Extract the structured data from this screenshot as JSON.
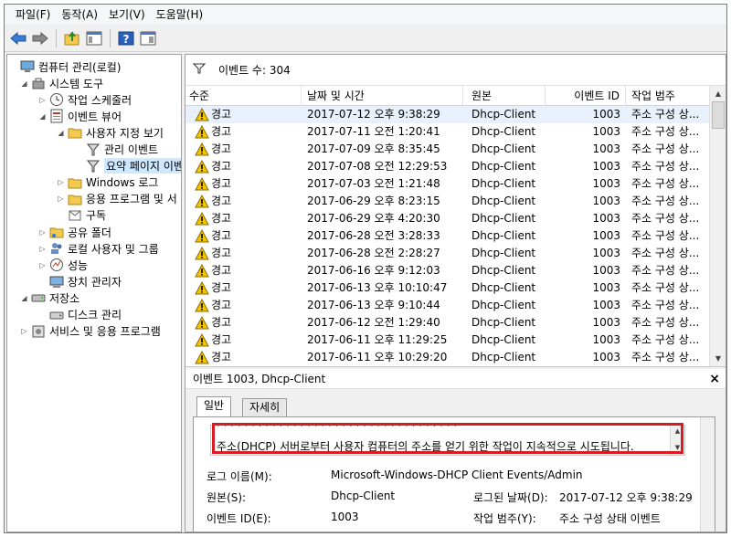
{
  "menubar": [
    "파일(F)",
    "동작(A)",
    "보기(V)",
    "도움말(H)"
  ],
  "tree": {
    "items": [
      {
        "label": "컴퓨터 관리(로컬)",
        "icon": "computer-icon",
        "level": 0,
        "twisty": ""
      },
      {
        "label": "시스템 도구",
        "icon": "tools-icon",
        "level": 1,
        "twisty": "◢"
      },
      {
        "label": "작업 스케줄러",
        "icon": "clock-icon",
        "level": 2,
        "twisty": "▷"
      },
      {
        "label": "이벤트 뷰어",
        "icon": "event-viewer-icon",
        "level": 2,
        "twisty": "◢"
      },
      {
        "label": "사용자 지정 보기",
        "icon": "folder-icon",
        "level": 3,
        "twisty": "◢"
      },
      {
        "label": "관리 이벤트",
        "icon": "filter-icon",
        "level": 4,
        "twisty": ""
      },
      {
        "label": "요약 페이지 이벤트",
        "icon": "filter-icon",
        "level": 4,
        "twisty": "",
        "selected": true
      },
      {
        "label": "Windows 로그",
        "icon": "folder-icon",
        "level": 3,
        "twisty": "▷"
      },
      {
        "label": "응용 프로그램 및 서",
        "icon": "folder-icon",
        "level": 3,
        "twisty": "▷"
      },
      {
        "label": "구독",
        "icon": "subscription-icon",
        "level": 3,
        "twisty": ""
      },
      {
        "label": "공유 폴더",
        "icon": "shared-folder-icon",
        "level": 2,
        "twisty": "▷"
      },
      {
        "label": "로컬 사용자 및 그룹",
        "icon": "users-icon",
        "level": 2,
        "twisty": "▷"
      },
      {
        "label": "성능",
        "icon": "performance-icon",
        "level": 2,
        "twisty": "▷"
      },
      {
        "label": "장치 관리자",
        "icon": "device-manager-icon",
        "level": 2,
        "twisty": ""
      },
      {
        "label": "저장소",
        "icon": "storage-icon",
        "level": 1,
        "twisty": "◢"
      },
      {
        "label": "디스크 관리",
        "icon": "disk-icon",
        "level": 2,
        "twisty": ""
      },
      {
        "label": "서비스 및 응용 프로그램",
        "icon": "services-icon",
        "level": 1,
        "twisty": "▷"
      }
    ]
  },
  "events": {
    "count_label": "이벤트 수: 304",
    "columns": [
      "수준",
      "날짜 및 시간",
      "원본",
      "이벤트 ID",
      "작업 범주"
    ],
    "rows": [
      [
        "경고",
        "2017-07-12 오후 9:38:29",
        "Dhcp-Client",
        "1003",
        "주소 구성 상..."
      ],
      [
        "경고",
        "2017-07-11 오전 1:20:41",
        "Dhcp-Client",
        "1003",
        "주소 구성 상..."
      ],
      [
        "경고",
        "2017-07-09 오후 8:35:45",
        "Dhcp-Client",
        "1003",
        "주소 구성 상..."
      ],
      [
        "경고",
        "2017-07-08 오전 12:29:53",
        "Dhcp-Client",
        "1003",
        "주소 구성 상..."
      ],
      [
        "경고",
        "2017-07-03 오전 1:21:48",
        "Dhcp-Client",
        "1003",
        "주소 구성 상..."
      ],
      [
        "경고",
        "2017-06-29 오후 8:23:15",
        "Dhcp-Client",
        "1003",
        "주소 구성 상..."
      ],
      [
        "경고",
        "2017-06-29 오후 4:20:30",
        "Dhcp-Client",
        "1003",
        "주소 구성 상..."
      ],
      [
        "경고",
        "2017-06-28 오전 3:28:33",
        "Dhcp-Client",
        "1003",
        "주소 구성 상..."
      ],
      [
        "경고",
        "2017-06-28 오전 2:28:27",
        "Dhcp-Client",
        "1003",
        "주소 구성 상..."
      ],
      [
        "경고",
        "2017-06-16 오후 9:12:03",
        "Dhcp-Client",
        "1003",
        "주소 구성 상..."
      ],
      [
        "경고",
        "2017-06-13 오후 10:10:47",
        "Dhcp-Client",
        "1003",
        "주소 구성 상..."
      ],
      [
        "경고",
        "2017-06-13 오후 9:10:44",
        "Dhcp-Client",
        "1003",
        "주소 구성 상..."
      ],
      [
        "경고",
        "2017-06-12 오전 1:29:40",
        "Dhcp-Client",
        "1003",
        "주소 구성 상..."
      ],
      [
        "경고",
        "2017-06-11 오후 11:29:25",
        "Dhcp-Client",
        "1003",
        "주소 구성 상..."
      ],
      [
        "경고",
        "2017-06-11 오후 10:29:20",
        "Dhcp-Client",
        "1003",
        "주소 구성 상..."
      ]
    ]
  },
  "detail": {
    "title": "이벤트 1003, Dhcp-Client",
    "close": "×",
    "tabs": [
      "일반",
      "자세히"
    ],
    "description": "주소(DHCP) 서버로부터 사용자 컴퓨터의 주소를 얻기 위한 작업이 지속적으로 시도됩니다.",
    "fields": {
      "log_name_label": "로그 이름(M):",
      "log_name_value": "Microsoft-Windows-DHCP Client Events/Admin",
      "source_label": "원본(S):",
      "source_value": "Dhcp-Client",
      "logged_label": "로그된 날짜(D):",
      "logged_value": "2017-07-12 오후 9:38:29",
      "event_id_label": "이벤트 ID(E):",
      "event_id_value": "1003",
      "category_label": "작업 범주(Y):",
      "category_value": "주소 구성 상태 이벤트"
    }
  },
  "colors": {
    "highlight": "#d81c24",
    "warning": "#f5c400",
    "selection": "#cde8ff"
  }
}
